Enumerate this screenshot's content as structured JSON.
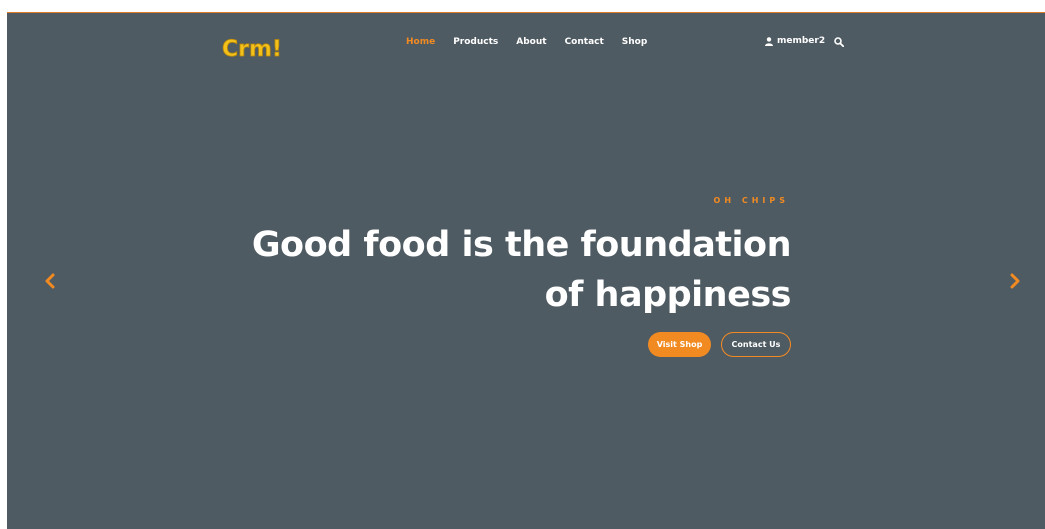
{
  "brand": {
    "logo_text": "Crm!",
    "accent_color": "#f28a22",
    "hero_bg_color": "#4f5b62"
  },
  "nav": {
    "items": [
      {
        "label": "Home",
        "active": true
      },
      {
        "label": "Products",
        "active": false
      },
      {
        "label": "About",
        "active": false
      },
      {
        "label": "Contact",
        "active": false
      },
      {
        "label": "Shop",
        "active": false
      }
    ]
  },
  "user": {
    "name": "member2",
    "icon": "user-icon"
  },
  "search": {
    "icon": "search-icon"
  },
  "hero": {
    "eyebrow": "OH CHIPS",
    "headline_line1": "Good food is the foundation",
    "headline_line2": "of happiness",
    "primary_button": "Visit Shop",
    "secondary_button": "Contact Us"
  },
  "carousel": {
    "prev_icon": "chevron-left-icon",
    "next_icon": "chevron-right-icon"
  }
}
